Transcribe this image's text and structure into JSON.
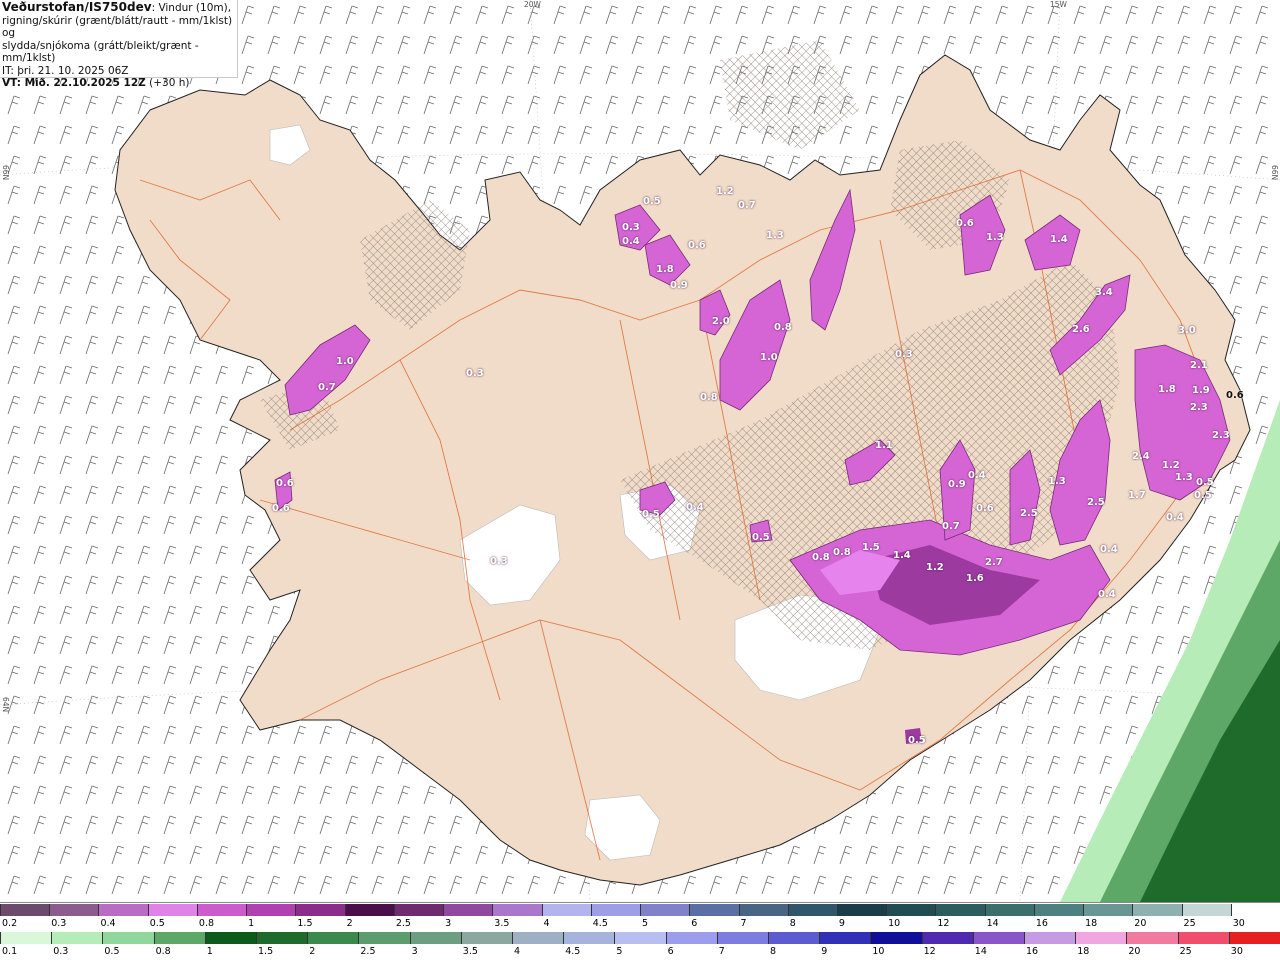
{
  "header": {
    "brand": "Veðurstofan/IS750dev",
    "desc_1": ": Vindur (10m),",
    "desc_2": "rigning/skúrir (grænt/blátt/rautt - mm/1klst) og",
    "desc_3": "slydda/snjókoma (grátt/bleikt/grænt - mm/1klst)",
    "it_line": "IT: þri. 21. 10. 2025 06Z",
    "vt_line": "VT: Mið. 22.10.2025 12Z",
    "vt_offset": " (+30 h)"
  },
  "grid_labels": {
    "lon_20w": "20W",
    "lon_15w": "15W",
    "lat_66n_left": "66N",
    "lat_66n_right": "66N",
    "lat_64n_left": "64N"
  },
  "precip_labels": [
    {
      "v": "0.5"
    },
    {
      "v": "0.3"
    },
    {
      "v": "0.4"
    },
    {
      "v": "1.8"
    },
    {
      "v": "0.6"
    },
    {
      "v": "0.9"
    },
    {
      "v": "1.2"
    },
    {
      "v": "0.7"
    },
    {
      "v": "1.3"
    },
    {
      "v": "2.0"
    },
    {
      "v": "0.8"
    },
    {
      "v": "1.0"
    },
    {
      "v": "0.7"
    },
    {
      "v": "1.0"
    },
    {
      "v": "0.6"
    },
    {
      "v": "0.6"
    },
    {
      "v": "0.3"
    },
    {
      "v": "0.3"
    },
    {
      "v": "0.6"
    },
    {
      "v": "1.3"
    },
    {
      "v": "1.4"
    },
    {
      "v": "2.6"
    },
    {
      "v": "3.4"
    },
    {
      "v": "3.0"
    },
    {
      "v": "1.8"
    },
    {
      "v": "1.9"
    },
    {
      "v": "2.3"
    },
    {
      "v": "2.3"
    },
    {
      "v": "2.1"
    },
    {
      "v": "2.4"
    },
    {
      "v": "1.2"
    },
    {
      "v": "1.3"
    },
    {
      "v": "0.5"
    },
    {
      "v": "0.4"
    },
    {
      "v": "1.7"
    },
    {
      "v": "2.5"
    },
    {
      "v": "1.3"
    },
    {
      "v": "0.9"
    },
    {
      "v": "0.6"
    },
    {
      "v": "2.5"
    },
    {
      "v": "2.7"
    },
    {
      "v": "1.6"
    },
    {
      "v": "1.2"
    },
    {
      "v": "1.4"
    },
    {
      "v": "0.8"
    },
    {
      "v": "0.8"
    },
    {
      "v": "1.5"
    },
    {
      "v": "0.4"
    },
    {
      "v": "0.5"
    },
    {
      "v": "0.4"
    },
    {
      "v": "0.3"
    },
    {
      "v": "1.1"
    },
    {
      "v": "0.5"
    },
    {
      "v": "0.4"
    },
    {
      "v": "0.7"
    },
    {
      "v": "0.4"
    },
    {
      "v": "0.5"
    },
    {
      "v": "0.6"
    },
    {
      "v": "0.8"
    },
    {
      "v": "0.5"
    }
  ],
  "legend_top": {
    "labels": [
      "0.2",
      "0.3",
      "0.4",
      "0.5",
      "0.8",
      "1",
      "1.5",
      "2",
      "2.5",
      "3",
      "3.5",
      "4",
      "4.5",
      "5",
      "6",
      "7",
      "8",
      "9",
      "10",
      "12",
      "14",
      "16",
      "18",
      "20",
      "25",
      "30"
    ],
    "colors": [
      "#6b4a6b",
      "#8c5c8c",
      "#b86cc4",
      "#e083e8",
      "#cc5ccc",
      "#b140b1",
      "#8c2d8c",
      "#4a0e4a",
      "#6e2b6e",
      "#8f4a9f",
      "#aa77cc",
      "#b3b3ee",
      "#9e9ee6",
      "#8181c9",
      "#5a6fa3",
      "#486683",
      "#2f566b",
      "#1a3d4a",
      "#1f4d52",
      "#2a5e5e",
      "#3a6f6b",
      "#4d8080",
      "#6b9696",
      "#8fb0b0",
      "#c5d6d6",
      "#ffffff"
    ]
  },
  "legend_bottom": {
    "labels": [
      "0.1",
      "0.3",
      "0.5",
      "0.8",
      "1",
      "1.5",
      "2",
      "2.5",
      "3",
      "3.5",
      "4",
      "4.5",
      "5",
      "6",
      "7",
      "8",
      "9",
      "10",
      "12",
      "14",
      "16",
      "18",
      "20",
      "25",
      "30"
    ],
    "colors": [
      "#d9f7d9",
      "#b5ecb8",
      "#8fd79a",
      "#5ea867",
      "#0d5a1a",
      "#1f6b2b",
      "#3c8a4b",
      "#5d9c6d",
      "#6e9e82",
      "#8ba8a0",
      "#9eb0c4",
      "#a5b3dd",
      "#b7bff0",
      "#9d9ded",
      "#7d7de0",
      "#5c5cd0",
      "#3131b8",
      "#0f0f9a",
      "#4f2ab0",
      "#8a55c9",
      "#c79be4",
      "#f0a6e0",
      "#f07aa0",
      "#f04e6a",
      "#e62020"
    ]
  }
}
